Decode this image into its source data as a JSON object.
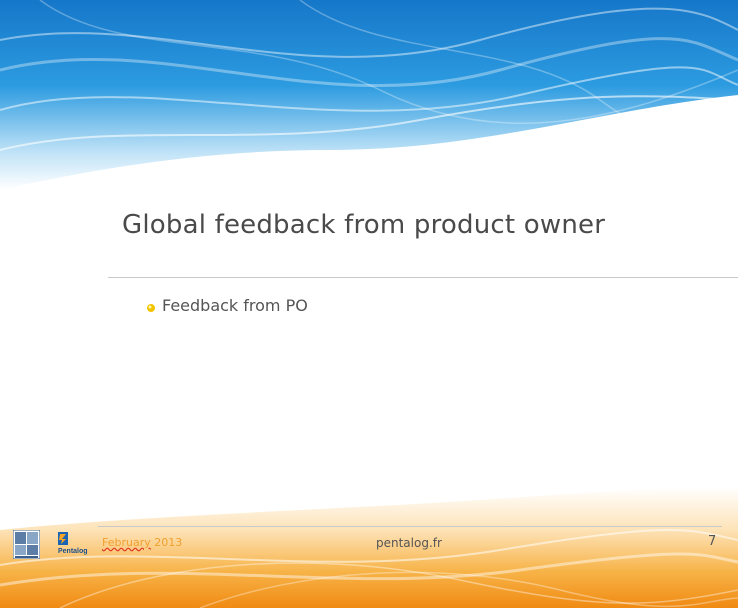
{
  "slide": {
    "title": "Global feedback from product owner",
    "bullets": [
      "Feedback from PO"
    ],
    "page_number": "7"
  },
  "footer": {
    "date_month": "February",
    "date_year": " 2013",
    "site": "pentalog.fr",
    "logo_text": "Pentalog"
  },
  "colors": {
    "banner_top": "#1e8fd8",
    "banner_bottom": "#f39a1a",
    "title": "#4a4a4a",
    "footer_date": "#f0a030",
    "bullet": "#f2c400"
  }
}
